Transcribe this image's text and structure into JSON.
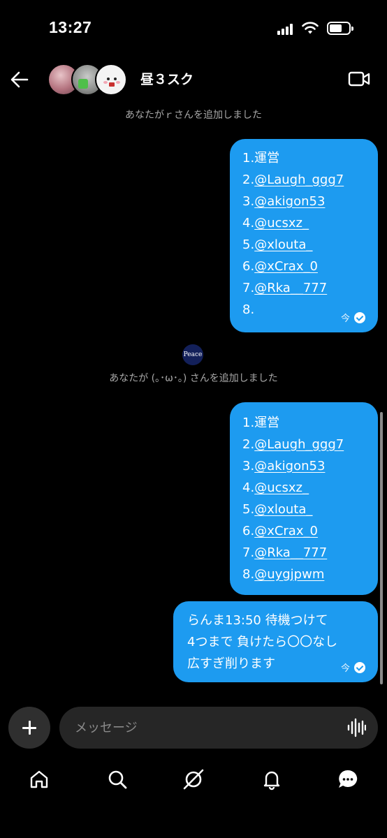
{
  "status_bar": {
    "time": "13:27",
    "battery_level": 0.55
  },
  "header": {
    "title": "昼３スク",
    "icons": [
      "back-arrow-icon",
      "video-call-icon"
    ],
    "avatars": [
      "member-avatar-1",
      "member-avatar-2",
      "member-avatar-3"
    ]
  },
  "messages": {
    "system_1": "あなたがｒさんを追加しました",
    "system_2": "あなたが (｡･ω･｡) さんを追加しました",
    "system_2_avatar_text": "Peace",
    "bubble_1": {
      "lines": [
        "1.運営",
        "2.@Laugh_ggg7",
        "3.@akigon53",
        "4.@ucsxz_",
        "5.@xlouta_",
        "6.@xCrax_0",
        "7.@Rka__777",
        "8."
      ],
      "time": "今"
    },
    "bubble_2": {
      "lines": [
        "1.運営",
        "2.@Laugh_ggg7",
        "3.@akigon53",
        "4.@ucsxz_",
        "5.@xlouta_",
        "6.@xCrax_0",
        "7.@Rka__777",
        "8.@uygjpwm"
      ]
    },
    "bubble_3": {
      "lines": [
        "らんま13:50 待機つけて",
        "4つまで 負けたら〇〇なし",
        "広すぎ削ります"
      ],
      "time": "今"
    }
  },
  "composer": {
    "placeholder": "メッセージ"
  },
  "tabbar": {
    "items": [
      "home-icon",
      "search-icon",
      "grok-icon",
      "notifications-icon",
      "messages-icon"
    ]
  },
  "colors": {
    "bubble": "#1d9bf0",
    "background": "#000000",
    "input": "#262626",
    "system_text": "#a8a8a8"
  }
}
